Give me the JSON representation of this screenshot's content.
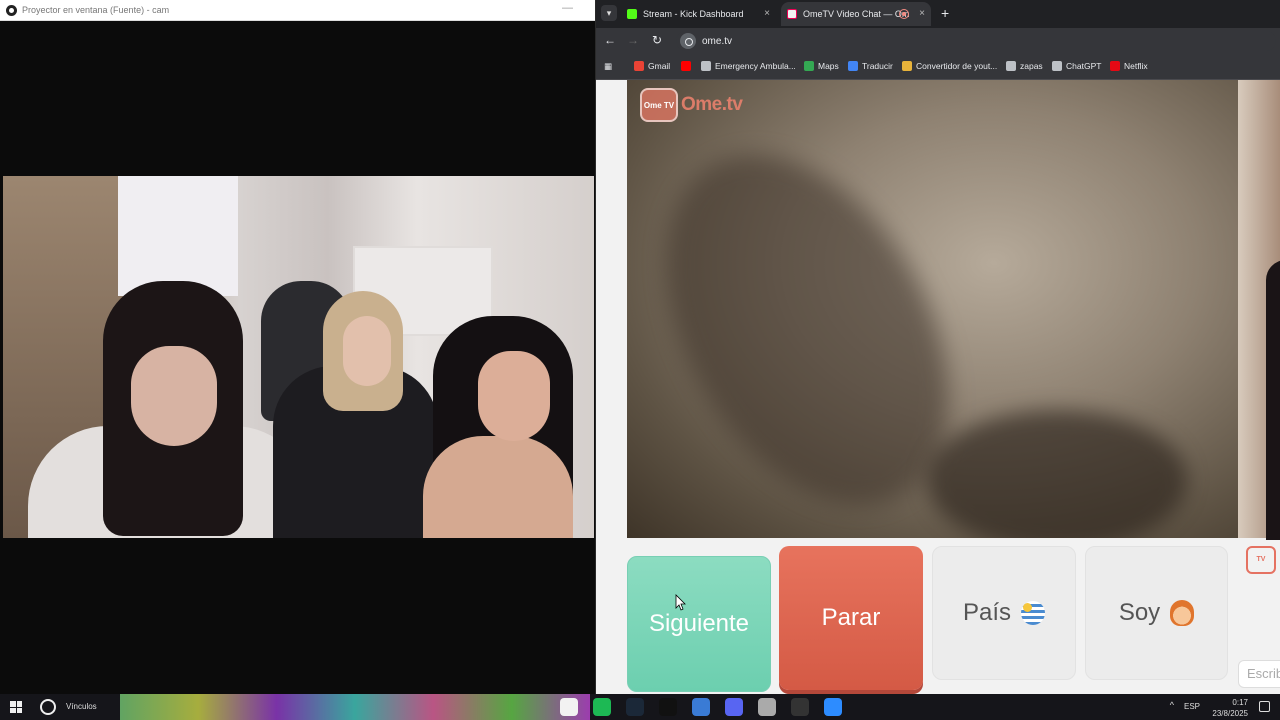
{
  "projector": {
    "title": "Proyector en ventana (Fuente) - cam",
    "minimize": "—"
  },
  "browser": {
    "tabs": [
      {
        "label": "Stream - Kick Dashboard",
        "close": "×"
      },
      {
        "label": "OmeTV Video Chat — Om",
        "close": "×"
      }
    ],
    "new_tab": "+",
    "url": "ome.tv",
    "nav": {
      "back": "←",
      "forward": "→",
      "reload": "↻"
    },
    "bookmarks": [
      "Gmail",
      "Emergency Ambula...",
      "Maps",
      "Traducir",
      "Convertidor de yout...",
      "zapas",
      "ChatGPT",
      "Netflix"
    ],
    "bookmark_colors": [
      "#ea4335",
      "#ff0000",
      "#bdc1c6",
      "#34a853",
      "#4285f4",
      "#e8b33a",
      "#bdc1c6",
      "#bdc1c6",
      "#e50914"
    ]
  },
  "ometv": {
    "logo_icon": "Ome TV",
    "logo_text": "Ome.tv",
    "buttons": {
      "next": "Siguiente",
      "stop": "Parar",
      "country": "País",
      "gender": "Soy"
    },
    "side_logo": "TV",
    "chat_placeholder": "Escrib"
  },
  "taskbar": {
    "search_label": "Vínculos",
    "language": "ESP",
    "time": "0:17",
    "date": "23/8/2025",
    "caret": "^",
    "icon_colors": [
      "#f2f2f2",
      "#1db954",
      "#1b2838",
      "#111111",
      "#3a7bd5",
      "#5865f2",
      "#aaaaaa",
      "#333333",
      "#2d8cff"
    ]
  }
}
